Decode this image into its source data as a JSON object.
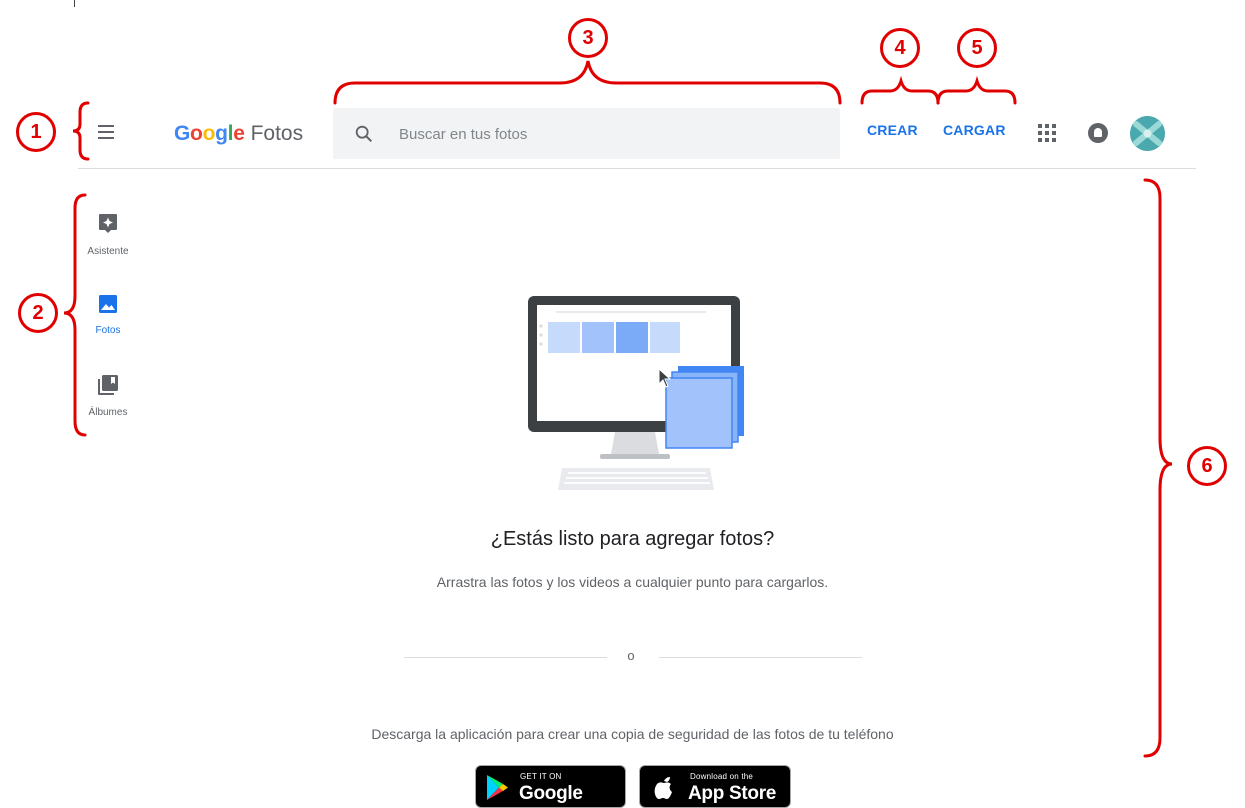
{
  "app": {
    "logo_google": "Google",
    "logo_product": "Fotos"
  },
  "header": {
    "search_placeholder": "Buscar en tus fotos",
    "create_label": "CREAR",
    "upload_label": "CARGAR"
  },
  "sidebar": {
    "items": [
      {
        "label": "Asistente",
        "icon": "assistant-icon",
        "active": false
      },
      {
        "label": "Fotos",
        "icon": "photo-icon",
        "active": true
      },
      {
        "label": "Álbumes",
        "icon": "albums-icon",
        "active": false
      }
    ]
  },
  "main": {
    "heading": "¿Estás listo para agregar fotos?",
    "subtext": "Arrastra las fotos y los videos a cualquier punto para cargarlos.",
    "or_text": "o",
    "download_text": "Descarga la aplicación para crear una copia de seguridad de las fotos de tu teléfono"
  },
  "stores": {
    "google_play_small": "GET IT ON",
    "google_play_big": "Google Play",
    "app_store_small": "Download on the",
    "app_store_big": "App Store"
  },
  "annotations": {
    "labels": [
      "1",
      "2",
      "3",
      "4",
      "5",
      "6"
    ]
  },
  "colors": {
    "accent": "#1a73e8",
    "annotation": "#e00000",
    "search_bg": "#f1f3f4",
    "icon_gray": "#5f6368"
  }
}
